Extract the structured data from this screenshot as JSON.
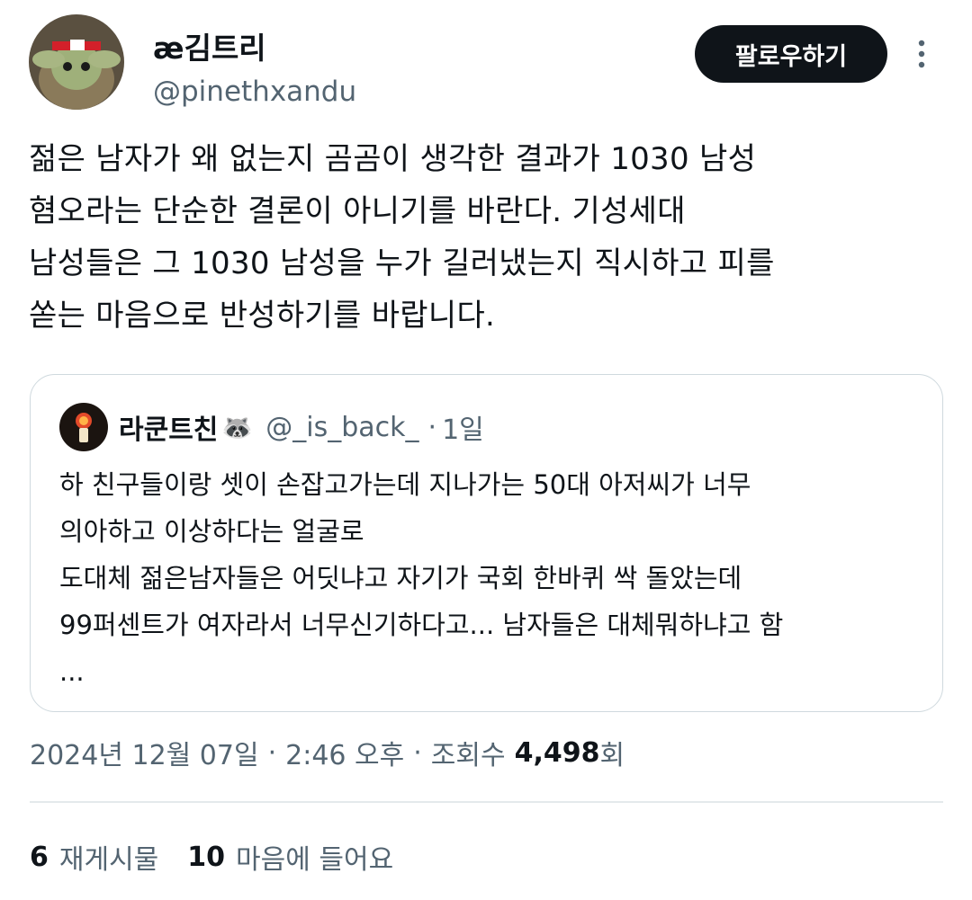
{
  "author": {
    "display_name": "æ김트리",
    "handle": "@pinethxandu"
  },
  "follow_button": {
    "label": "팔로우하기"
  },
  "tweet": {
    "text": "젊은 남자가 왜 없는지 곰곰이 생각한 결과가 1030 남성\n혐오라는 단순한 결론이 아니기를 바란다. 기성세대\n남성들은 그 1030 남성을 누가 길러냈는지 직시하고 피를\n쏟는 마음으로 반성하기를 바랍니다."
  },
  "quote": {
    "name": "라쿤트친",
    "emoji": "🦝",
    "handle": "@_is_back_",
    "dot": "·",
    "time": "1일",
    "text": "하 친구들이랑 셋이 손잡고가는데 지나가는 50대 아저씨가 너무\n의아하고 이상하다는 얼굴로\n도대체 젊은남자들은 어딧냐고 자기가 국회 한바퀴 싹 돌았는데\n99퍼센트가 여자라서 너무신기하다고... 남자들은 대체뭐하냐고 함\n..."
  },
  "meta": {
    "date": "2024년 12월 07일",
    "sep1": "·",
    "time": "2:46 오후",
    "sep2": "·",
    "views_label": "조회수",
    "views_count": "4,498",
    "views_suffix": "회"
  },
  "stats": {
    "reposts_count": "6",
    "reposts_label": "재게시물",
    "likes_count": "10",
    "likes_label": "마음에 들어요"
  },
  "icons": {
    "more": "more-vertical-icon"
  },
  "colors": {
    "primary_text": "#0f1419",
    "secondary_text": "#536471",
    "border": "#cfd9de",
    "button_bg": "#0f1419"
  }
}
